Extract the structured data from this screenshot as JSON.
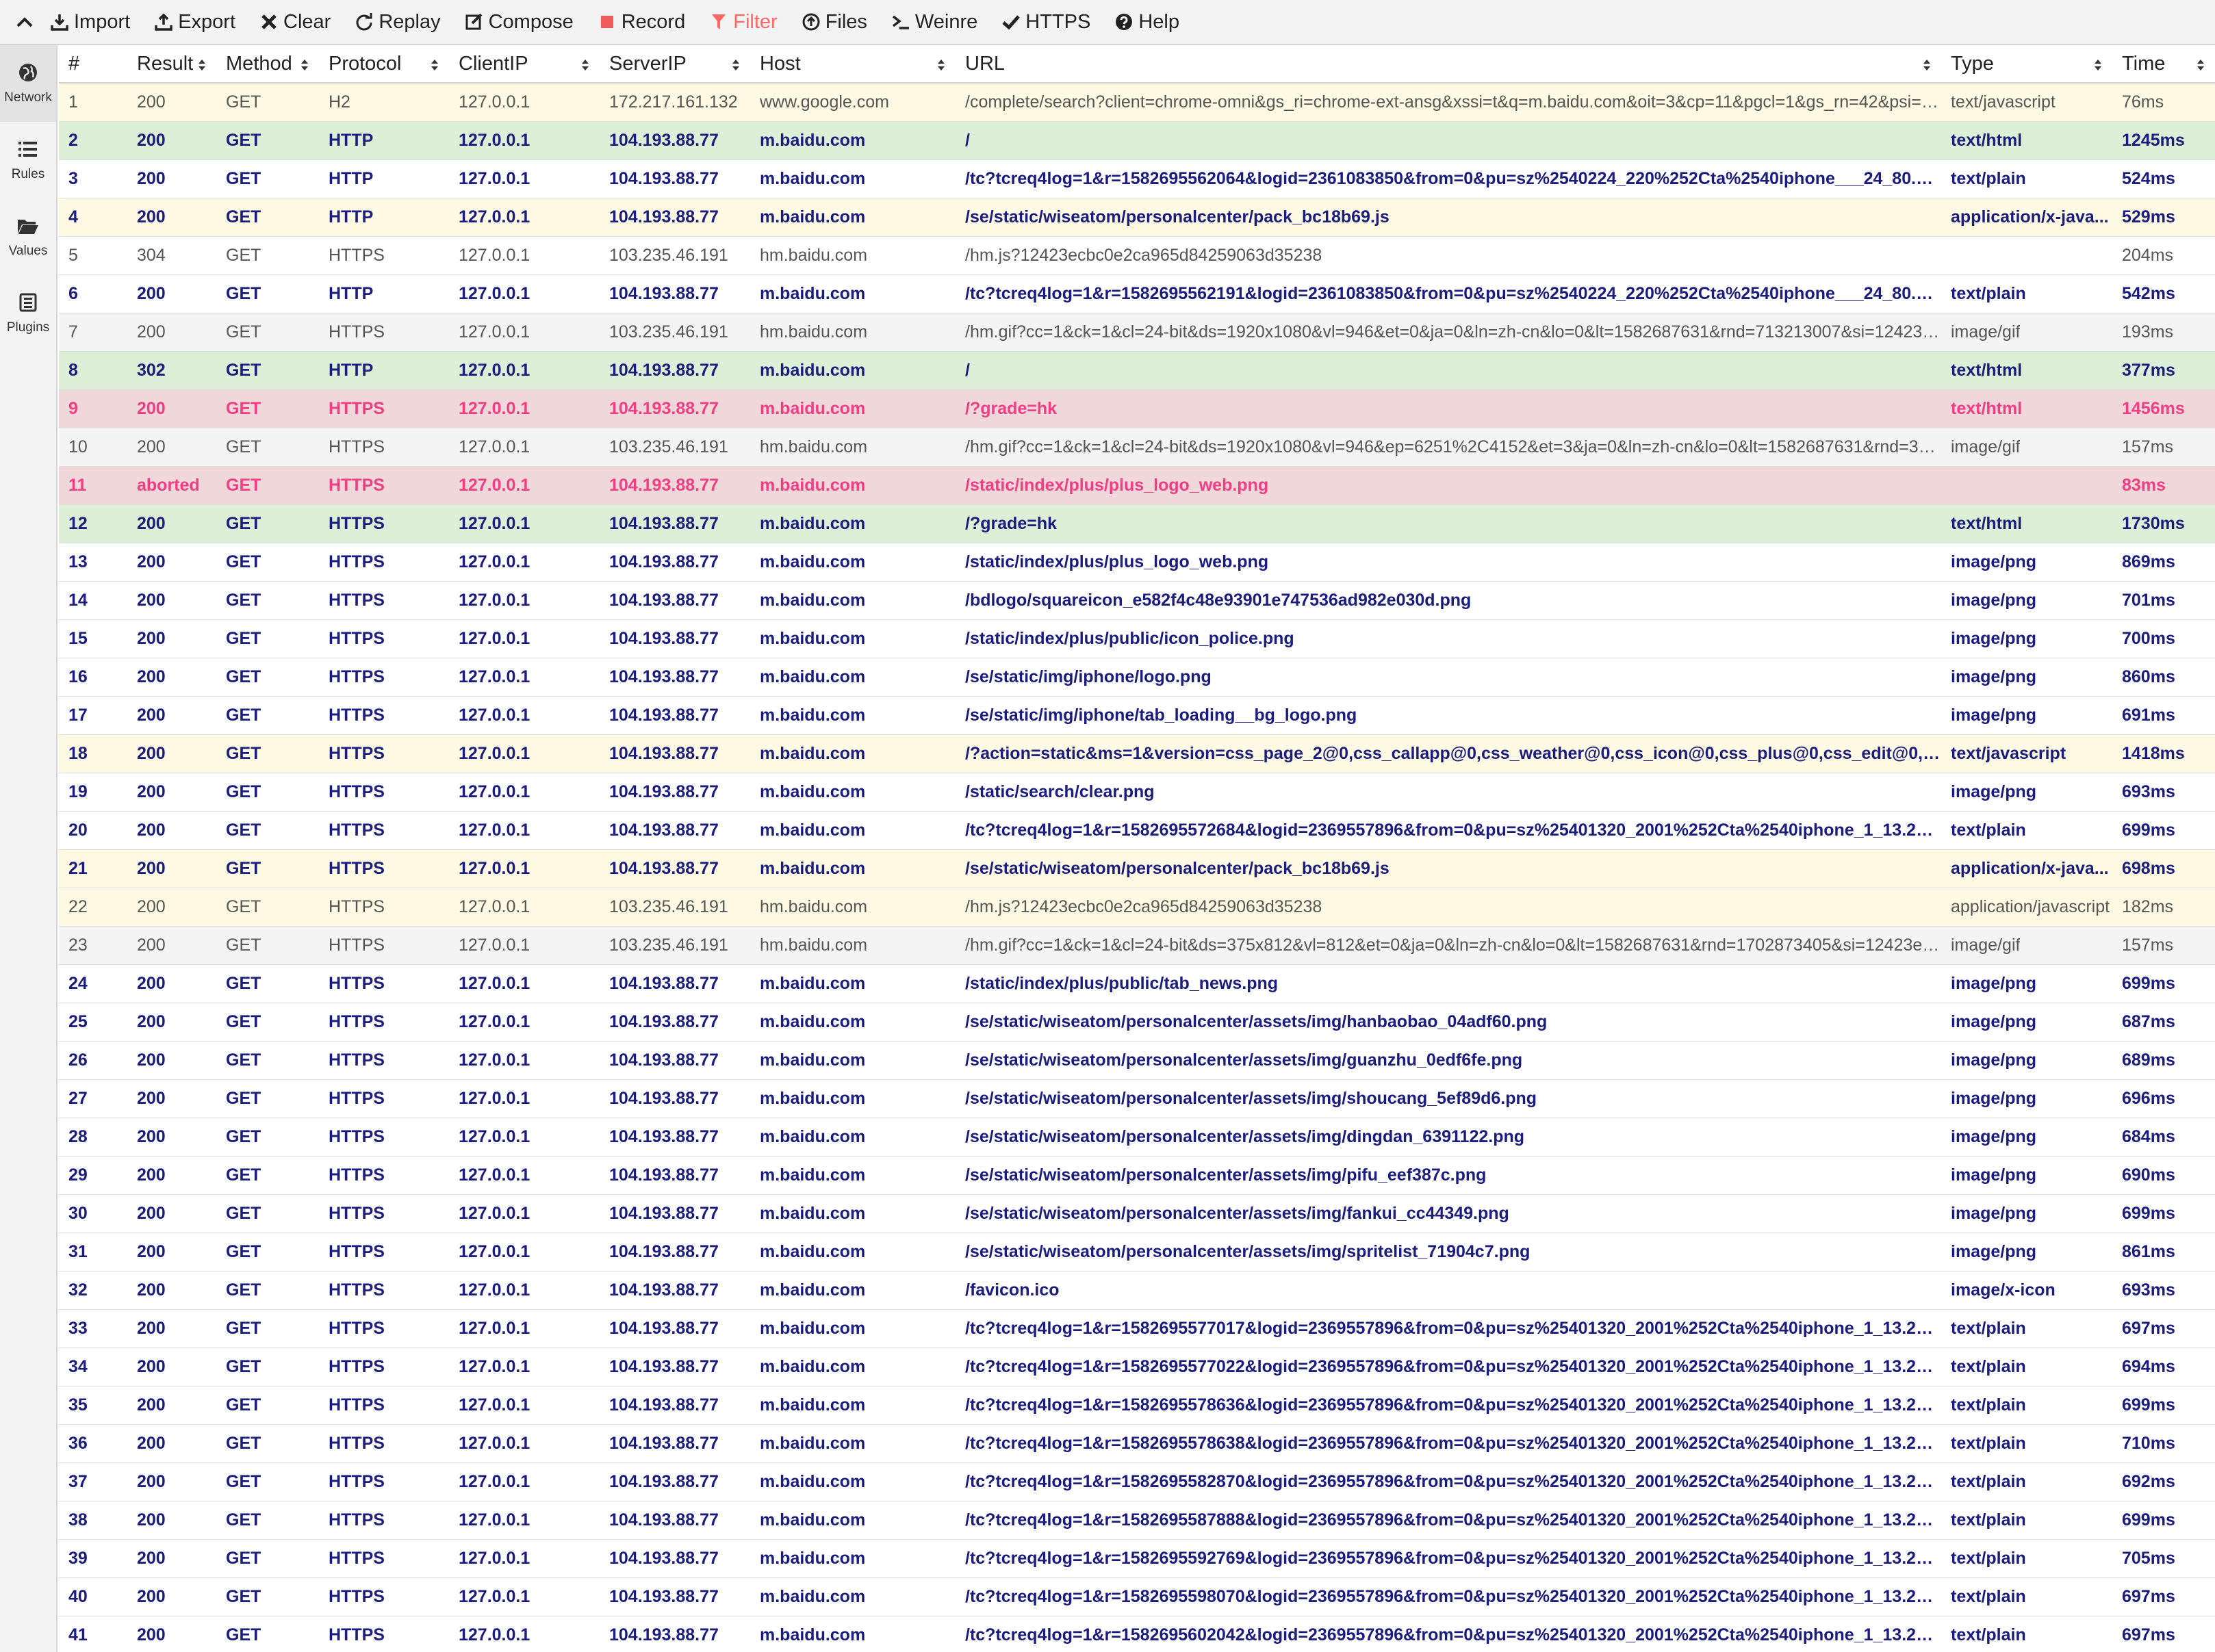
{
  "toolbar": {
    "items": [
      {
        "label": "Import",
        "icon": "import-icon"
      },
      {
        "label": "Export",
        "icon": "export-icon"
      },
      {
        "label": "Clear",
        "icon": "clear-icon"
      },
      {
        "label": "Replay",
        "icon": "replay-icon"
      },
      {
        "label": "Compose",
        "icon": "compose-icon"
      },
      {
        "label": "Record",
        "icon": "record-icon"
      },
      {
        "label": "Filter",
        "icon": "filter-icon",
        "color": "#ff6666"
      },
      {
        "label": "Files",
        "icon": "files-icon"
      },
      {
        "label": "Weinre",
        "icon": "weinre-icon"
      },
      {
        "label": "HTTPS",
        "icon": "https-icon"
      },
      {
        "label": "Help",
        "icon": "help-icon"
      }
    ]
  },
  "sidebar": {
    "items": [
      {
        "label": "Network",
        "icon": "globe-icon",
        "active": true
      },
      {
        "label": "Rules",
        "icon": "list-icon",
        "active": false
      },
      {
        "label": "Values",
        "icon": "folder-icon",
        "active": false
      },
      {
        "label": "Plugins",
        "icon": "plugins-icon",
        "active": false
      }
    ]
  },
  "columns": [
    "#",
    "Result",
    "Method",
    "Protocol",
    "ClientIP",
    "ServerIP",
    "Host",
    "URL",
    "Type",
    "Time"
  ],
  "colors": {
    "navy": "#1a1c7e",
    "pink": "#f03d84",
    "yellow_row": "#fdf9e2",
    "green_row": "#dbf0d6",
    "red_row": "#f0d7da"
  },
  "rows": [
    {
      "num": "1",
      "result": "200",
      "method": "GET",
      "protocol": "H2",
      "clientip": "127.0.0.1",
      "serverip": "172.217.161.132",
      "host": "www.google.com",
      "url": "/complete/search?client=chrome-omni&gs_ri=chrome-ext-ansg&xssi=t&q=m.baidu.com&oit=3&cp=11&pgcl=1&gs_rn=42&psi=mh...",
      "type": "text/javascript",
      "time": "76ms",
      "style": "yellow dim"
    },
    {
      "num": "2",
      "result": "200",
      "method": "GET",
      "protocol": "HTTP",
      "clientip": "127.0.0.1",
      "serverip": "104.193.88.77",
      "host": "m.baidu.com",
      "url": "/",
      "type": "text/html",
      "time": "1245ms",
      "style": "green bold navy"
    },
    {
      "num": "3",
      "result": "200",
      "method": "GET",
      "protocol": "HTTP",
      "clientip": "127.0.0.1",
      "serverip": "104.193.88.77",
      "host": "m.baidu.com",
      "url": "/tc?tcreq4log=1&r=1582695562064&logid=2361083850&from=0&pu=sz%2540224_220%252Cta%2540iphone___24_80.0&ct=...",
      "type": "text/plain",
      "time": "524ms",
      "style": "bold navy"
    },
    {
      "num": "4",
      "result": "200",
      "method": "GET",
      "protocol": "HTTP",
      "clientip": "127.0.0.1",
      "serverip": "104.193.88.77",
      "host": "m.baidu.com",
      "url": "/se/static/wiseatom/personalcenter/pack_bc18b69.js",
      "type": "application/x-java...",
      "time": "529ms",
      "style": "yellow bold navy"
    },
    {
      "num": "5",
      "result": "304",
      "method": "GET",
      "protocol": "HTTPS",
      "clientip": "127.0.0.1",
      "serverip": "103.235.46.191",
      "host": "hm.baidu.com",
      "url": "/hm.js?12423ecbc0e2ca965d84259063d35238",
      "type": "",
      "time": "204ms",
      "style": "dim"
    },
    {
      "num": "6",
      "result": "200",
      "method": "GET",
      "protocol": "HTTP",
      "clientip": "127.0.0.1",
      "serverip": "104.193.88.77",
      "host": "m.baidu.com",
      "url": "/tc?tcreq4log=1&r=1582695562191&logid=2361083850&from=0&pu=sz%2540224_220%252Cta%2540iphone___24_80.0&ct=...",
      "type": "text/plain",
      "time": "542ms",
      "style": "bold navy"
    },
    {
      "num": "7",
      "result": "200",
      "method": "GET",
      "protocol": "HTTPS",
      "clientip": "127.0.0.1",
      "serverip": "103.235.46.191",
      "host": "hm.baidu.com",
      "url": "/hm.gif?cc=1&ck=1&cl=24-bit&ds=1920x1080&vl=946&et=0&ja=0&ln=zh-cn&lo=0&lt=1582687631&rnd=713213007&si=12423ecb...",
      "type": "image/gif",
      "time": "193ms",
      "style": "grey dim"
    },
    {
      "num": "8",
      "result": "302",
      "method": "GET",
      "protocol": "HTTP",
      "clientip": "127.0.0.1",
      "serverip": "104.193.88.77",
      "host": "m.baidu.com",
      "url": "/",
      "type": "text/html",
      "time": "377ms",
      "style": "green bold navy"
    },
    {
      "num": "9",
      "result": "200",
      "method": "GET",
      "protocol": "HTTPS",
      "clientip": "127.0.0.1",
      "serverip": "104.193.88.77",
      "host": "m.baidu.com",
      "url": "/?grade=hk",
      "type": "text/html",
      "time": "1456ms",
      "style": "red bold pink"
    },
    {
      "num": "10",
      "result": "200",
      "method": "GET",
      "protocol": "HTTPS",
      "clientip": "127.0.0.1",
      "serverip": "103.235.46.191",
      "host": "hm.baidu.com",
      "url": "/hm.gif?cc=1&ck=1&cl=24-bit&ds=1920x1080&vl=946&ep=6251%2C4152&et=3&ja=0&ln=zh-cn&lo=0&lt=1582687631&rnd=30492...",
      "type": "image/gif",
      "time": "157ms",
      "style": "grey dim"
    },
    {
      "num": "11",
      "result": "aborted",
      "method": "GET",
      "protocol": "HTTPS",
      "clientip": "127.0.0.1",
      "serverip": "104.193.88.77",
      "host": "m.baidu.com",
      "url": "/static/index/plus/plus_logo_web.png",
      "type": "",
      "time": "83ms",
      "style": "red bold pink"
    },
    {
      "num": "12",
      "result": "200",
      "method": "GET",
      "protocol": "HTTPS",
      "clientip": "127.0.0.1",
      "serverip": "104.193.88.77",
      "host": "m.baidu.com",
      "url": "/?grade=hk",
      "type": "text/html",
      "time": "1730ms",
      "style": "green bold navy"
    },
    {
      "num": "13",
      "result": "200",
      "method": "GET",
      "protocol": "HTTPS",
      "clientip": "127.0.0.1",
      "serverip": "104.193.88.77",
      "host": "m.baidu.com",
      "url": "/static/index/plus/plus_logo_web.png",
      "type": "image/png",
      "time": "869ms",
      "style": "bold navy"
    },
    {
      "num": "14",
      "result": "200",
      "method": "GET",
      "protocol": "HTTPS",
      "clientip": "127.0.0.1",
      "serverip": "104.193.88.77",
      "host": "m.baidu.com",
      "url": "/bdlogo/squareicon_e582f4c48e93901e747536ad982e030d.png",
      "type": "image/png",
      "time": "701ms",
      "style": "bold navy"
    },
    {
      "num": "15",
      "result": "200",
      "method": "GET",
      "protocol": "HTTPS",
      "clientip": "127.0.0.1",
      "serverip": "104.193.88.77",
      "host": "m.baidu.com",
      "url": "/static/index/plus/public/icon_police.png",
      "type": "image/png",
      "time": "700ms",
      "style": "bold navy"
    },
    {
      "num": "16",
      "result": "200",
      "method": "GET",
      "protocol": "HTTPS",
      "clientip": "127.0.0.1",
      "serverip": "104.193.88.77",
      "host": "m.baidu.com",
      "url": "/se/static/img/iphone/logo.png",
      "type": "image/png",
      "time": "860ms",
      "style": "bold navy"
    },
    {
      "num": "17",
      "result": "200",
      "method": "GET",
      "protocol": "HTTPS",
      "clientip": "127.0.0.1",
      "serverip": "104.193.88.77",
      "host": "m.baidu.com",
      "url": "/se/static/img/iphone/tab_loading__bg_logo.png",
      "type": "image/png",
      "time": "691ms",
      "style": "bold navy"
    },
    {
      "num": "18",
      "result": "200",
      "method": "GET",
      "protocol": "HTTPS",
      "clientip": "127.0.0.1",
      "serverip": "104.193.88.77",
      "host": "m.baidu.com",
      "url": "/?action=static&ms=1&version=css_page_2@0,css_callapp@0,css_weather@0,css_icon@0,css_plus@0,css_edit@0,css_mo...",
      "type": "text/javascript",
      "time": "1418ms",
      "style": "yellow bold navy"
    },
    {
      "num": "19",
      "result": "200",
      "method": "GET",
      "protocol": "HTTPS",
      "clientip": "127.0.0.1",
      "serverip": "104.193.88.77",
      "host": "m.baidu.com",
      "url": "/static/search/clear.png",
      "type": "image/png",
      "time": "693ms",
      "style": "bold navy"
    },
    {
      "num": "20",
      "result": "200",
      "method": "GET",
      "protocol": "HTTPS",
      "clientip": "127.0.0.1",
      "serverip": "104.193.88.77",
      "host": "m.baidu.com",
      "url": "/tc?tcreq4log=1&r=1582695572684&logid=2369557896&from=0&pu=sz%25401320_2001%252Cta%2540iphone_1_13.2_25_1...",
      "type": "text/plain",
      "time": "699ms",
      "style": "bold navy"
    },
    {
      "num": "21",
      "result": "200",
      "method": "GET",
      "protocol": "HTTPS",
      "clientip": "127.0.0.1",
      "serverip": "104.193.88.77",
      "host": "m.baidu.com",
      "url": "/se/static/wiseatom/personalcenter/pack_bc18b69.js",
      "type": "application/x-java...",
      "time": "698ms",
      "style": "yellow bold navy"
    },
    {
      "num": "22",
      "result": "200",
      "method": "GET",
      "protocol": "HTTPS",
      "clientip": "127.0.0.1",
      "serverip": "103.235.46.191",
      "host": "hm.baidu.com",
      "url": "/hm.js?12423ecbc0e2ca965d84259063d35238",
      "type": "application/javascript",
      "time": "182ms",
      "style": "yellow dim"
    },
    {
      "num": "23",
      "result": "200",
      "method": "GET",
      "protocol": "HTTPS",
      "clientip": "127.0.0.1",
      "serverip": "103.235.46.191",
      "host": "hm.baidu.com",
      "url": "/hm.gif?cc=1&ck=1&cl=24-bit&ds=375x812&vl=812&et=0&ja=0&ln=zh-cn&lo=0&lt=1582687631&rnd=1702873405&si=12423ecbc...",
      "type": "image/gif",
      "time": "157ms",
      "style": "grey dim"
    },
    {
      "num": "24",
      "result": "200",
      "method": "GET",
      "protocol": "HTTPS",
      "clientip": "127.0.0.1",
      "serverip": "104.193.88.77",
      "host": "m.baidu.com",
      "url": "/static/index/plus/public/tab_news.png",
      "type": "image/png",
      "time": "699ms",
      "style": "bold navy"
    },
    {
      "num": "25",
      "result": "200",
      "method": "GET",
      "protocol": "HTTPS",
      "clientip": "127.0.0.1",
      "serverip": "104.193.88.77",
      "host": "m.baidu.com",
      "url": "/se/static/wiseatom/personalcenter/assets/img/hanbaobao_04adf60.png",
      "type": "image/png",
      "time": "687ms",
      "style": "bold navy"
    },
    {
      "num": "26",
      "result": "200",
      "method": "GET",
      "protocol": "HTTPS",
      "clientip": "127.0.0.1",
      "serverip": "104.193.88.77",
      "host": "m.baidu.com",
      "url": "/se/static/wiseatom/personalcenter/assets/img/guanzhu_0edf6fe.png",
      "type": "image/png",
      "time": "689ms",
      "style": "bold navy"
    },
    {
      "num": "27",
      "result": "200",
      "method": "GET",
      "protocol": "HTTPS",
      "clientip": "127.0.0.1",
      "serverip": "104.193.88.77",
      "host": "m.baidu.com",
      "url": "/se/static/wiseatom/personalcenter/assets/img/shoucang_5ef89d6.png",
      "type": "image/png",
      "time": "696ms",
      "style": "bold navy"
    },
    {
      "num": "28",
      "result": "200",
      "method": "GET",
      "protocol": "HTTPS",
      "clientip": "127.0.0.1",
      "serverip": "104.193.88.77",
      "host": "m.baidu.com",
      "url": "/se/static/wiseatom/personalcenter/assets/img/dingdan_6391122.png",
      "type": "image/png",
      "time": "684ms",
      "style": "bold navy"
    },
    {
      "num": "29",
      "result": "200",
      "method": "GET",
      "protocol": "HTTPS",
      "clientip": "127.0.0.1",
      "serverip": "104.193.88.77",
      "host": "m.baidu.com",
      "url": "/se/static/wiseatom/personalcenter/assets/img/pifu_eef387c.png",
      "type": "image/png",
      "time": "690ms",
      "style": "bold navy"
    },
    {
      "num": "30",
      "result": "200",
      "method": "GET",
      "protocol": "HTTPS",
      "clientip": "127.0.0.1",
      "serverip": "104.193.88.77",
      "host": "m.baidu.com",
      "url": "/se/static/wiseatom/personalcenter/assets/img/fankui_cc44349.png",
      "type": "image/png",
      "time": "699ms",
      "style": "bold navy"
    },
    {
      "num": "31",
      "result": "200",
      "method": "GET",
      "protocol": "HTTPS",
      "clientip": "127.0.0.1",
      "serverip": "104.193.88.77",
      "host": "m.baidu.com",
      "url": "/se/static/wiseatom/personalcenter/assets/img/spritelist_71904c7.png",
      "type": "image/png",
      "time": "861ms",
      "style": "bold navy"
    },
    {
      "num": "32",
      "result": "200",
      "method": "GET",
      "protocol": "HTTPS",
      "clientip": "127.0.0.1",
      "serverip": "104.193.88.77",
      "host": "m.baidu.com",
      "url": "/favicon.ico",
      "type": "image/x-icon",
      "time": "693ms",
      "style": "bold navy"
    },
    {
      "num": "33",
      "result": "200",
      "method": "GET",
      "protocol": "HTTPS",
      "clientip": "127.0.0.1",
      "serverip": "104.193.88.77",
      "host": "m.baidu.com",
      "url": "/tc?tcreq4log=1&r=1582695577017&logid=2369557896&from=0&pu=sz%25401320_2001%252Cta%2540iphone_1_13.2_25_1...",
      "type": "text/plain",
      "time": "697ms",
      "style": "bold navy"
    },
    {
      "num": "34",
      "result": "200",
      "method": "GET",
      "protocol": "HTTPS",
      "clientip": "127.0.0.1",
      "serverip": "104.193.88.77",
      "host": "m.baidu.com",
      "url": "/tc?tcreq4log=1&r=1582695577022&logid=2369557896&from=0&pu=sz%25401320_2001%252Cta%2540iphone_1_13.2_25_1...",
      "type": "text/plain",
      "time": "694ms",
      "style": "bold navy"
    },
    {
      "num": "35",
      "result": "200",
      "method": "GET",
      "protocol": "HTTPS",
      "clientip": "127.0.0.1",
      "serverip": "104.193.88.77",
      "host": "m.baidu.com",
      "url": "/tc?tcreq4log=1&r=1582695578636&logid=2369557896&from=0&pu=sz%25401320_2001%252Cta%2540iphone_1_13.2_25_1...",
      "type": "text/plain",
      "time": "699ms",
      "style": "bold navy"
    },
    {
      "num": "36",
      "result": "200",
      "method": "GET",
      "protocol": "HTTPS",
      "clientip": "127.0.0.1",
      "serverip": "104.193.88.77",
      "host": "m.baidu.com",
      "url": "/tc?tcreq4log=1&r=1582695578638&logid=2369557896&from=0&pu=sz%25401320_2001%252Cta%2540iphone_1_13.2_25_1...",
      "type": "text/plain",
      "time": "710ms",
      "style": "bold navy"
    },
    {
      "num": "37",
      "result": "200",
      "method": "GET",
      "protocol": "HTTPS",
      "clientip": "127.0.0.1",
      "serverip": "104.193.88.77",
      "host": "m.baidu.com",
      "url": "/tc?tcreq4log=1&r=1582695582870&logid=2369557896&from=0&pu=sz%25401320_2001%252Cta%2540iphone_1_13.2_25_1...",
      "type": "text/plain",
      "time": "692ms",
      "style": "bold navy"
    },
    {
      "num": "38",
      "result": "200",
      "method": "GET",
      "protocol": "HTTPS",
      "clientip": "127.0.0.1",
      "serverip": "104.193.88.77",
      "host": "m.baidu.com",
      "url": "/tc?tcreq4log=1&r=1582695587888&logid=2369557896&from=0&pu=sz%25401320_2001%252Cta%2540iphone_1_13.2_25_1...",
      "type": "text/plain",
      "time": "699ms",
      "style": "bold navy"
    },
    {
      "num": "39",
      "result": "200",
      "method": "GET",
      "protocol": "HTTPS",
      "clientip": "127.0.0.1",
      "serverip": "104.193.88.77",
      "host": "m.baidu.com",
      "url": "/tc?tcreq4log=1&r=1582695592769&logid=2369557896&from=0&pu=sz%25401320_2001%252Cta%2540iphone_1_13.2_25_1...",
      "type": "text/plain",
      "time": "705ms",
      "style": "bold navy"
    },
    {
      "num": "40",
      "result": "200",
      "method": "GET",
      "protocol": "HTTPS",
      "clientip": "127.0.0.1",
      "serverip": "104.193.88.77",
      "host": "m.baidu.com",
      "url": "/tc?tcreq4log=1&r=1582695598070&logid=2369557896&from=0&pu=sz%25401320_2001%252Cta%2540iphone_1_13.2_25_1...",
      "type": "text/plain",
      "time": "697ms",
      "style": "bold navy"
    },
    {
      "num": "41",
      "result": "200",
      "method": "GET",
      "protocol": "HTTPS",
      "clientip": "127.0.0.1",
      "serverip": "104.193.88.77",
      "host": "m.baidu.com",
      "url": "/tc?tcreq4log=1&r=1582695602042&logid=2369557896&from=0&pu=sz%25401320_2001%252Cta%2540iphone_1_13.2_25_1...",
      "type": "text/plain",
      "time": "697ms",
      "style": "bold navy"
    }
  ]
}
